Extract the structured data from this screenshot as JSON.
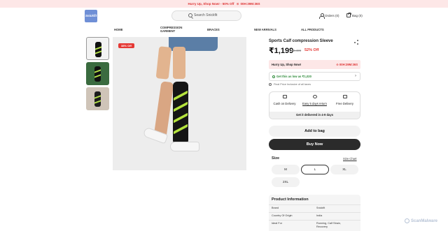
{
  "promo_bar": {
    "left": "Hurry Up, Shop Now! - 50% Off",
    "right": "00H:39M:36S"
  },
  "header": {
    "logo": "Snickfit",
    "search_placeholder": "Search Snickfit",
    "orders": "Orders (0)",
    "bag": "Bag (0)"
  },
  "nav": {
    "home": "HOME",
    "compression": "COMPRESSION GARMENT",
    "braces": "BRACES",
    "new_arrivals": "NEW ARRIVALS",
    "all_products": "ALL PRODUCTS"
  },
  "product": {
    "discount_badge": "38% Off",
    "title": "Sports Calf compression Sleeve",
    "price": "₹1,199",
    "mrp": "₹2,499",
    "off": "52% Off",
    "hurry": {
      "label": "Hurry Up, Shop Now!",
      "timer": "00H:39M:36S"
    },
    "coupon": "Get this as low as ₹1,020",
    "price_note": "Final Price Inclusive of all taxes",
    "features": [
      "Cash on Delivery",
      "Easy 5 days return",
      "Free Delivery"
    ],
    "delivery_eta": "Get it delivered in 4-9 days",
    "add_to_bag": "Add to bag",
    "buy_now": "Buy Now"
  },
  "size": {
    "label": "Size",
    "chart_link": "Size Chart",
    "options": [
      "M",
      "L",
      "XL",
      "2XL"
    ],
    "selected": "L"
  },
  "product_info": {
    "heading": "Product Information",
    "rows": [
      {
        "key": "Brand",
        "value": "Snickfit"
      },
      {
        "key": "Country Of Origin",
        "value": "India"
      },
      {
        "key": "Ideal For",
        "value": "Running, Calf Strain, Recovery"
      }
    ]
  },
  "watermark": "ScanMalware"
}
